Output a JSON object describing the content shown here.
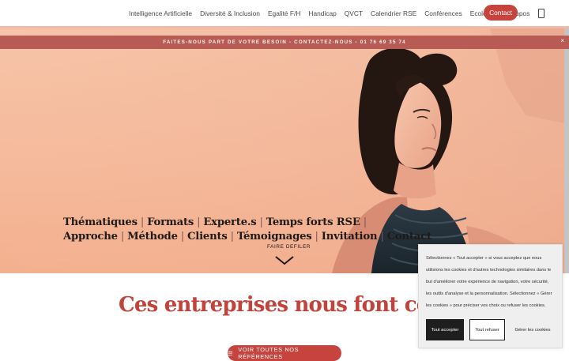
{
  "nav": {
    "items": [
      "Intelligence Artificielle",
      "Diversité & Inclusion",
      "Egalité F/H",
      "Handicap",
      "QVCT",
      "Calendrier RSE",
      "Conférences",
      "Ecologie",
      "À propos"
    ],
    "contact_label": "Contact"
  },
  "banner": {
    "text": "FAITES-NOUS PART DE VOTRE BESOIN - CONTACTEZ-NOUS - 01 76 69 35 74",
    "close": "×"
  },
  "hero": {
    "row1": [
      "Thématiques",
      "Formats",
      "Experte.s",
      "Temps forts RSE"
    ],
    "row2": [
      "Approche",
      "Méthode",
      "Clients",
      "Témoignages",
      "Invitation",
      "Contact"
    ],
    "separator": "|",
    "scroll_label": "FAIRE DEFILER"
  },
  "clients": {
    "title": "Ces entreprises nous font confia",
    "button_label": "VOIR TOUTES NOS RÉFÉRENCES",
    "button_icon": "list-icon"
  },
  "cookie": {
    "text": "Sélectionnez « Tout accepter » si vous acceptez que nous utilisions les cookies et d'autres technologies similaires dans le but d'améliorer votre expérience de navigation, votre sécurité, les outils d'analyse et la personnalisation. Sélectionnez « Gérer les cookies » pour préciser vos choix ou refuser les cookies.",
    "accept": "Tout accepter",
    "refuse": "Tout refuser",
    "manage": "Gérer les cookies"
  },
  "colors": {
    "accent": "#c7433d",
    "banner": "#b85b55",
    "hero_bg": "#f5b99a"
  }
}
